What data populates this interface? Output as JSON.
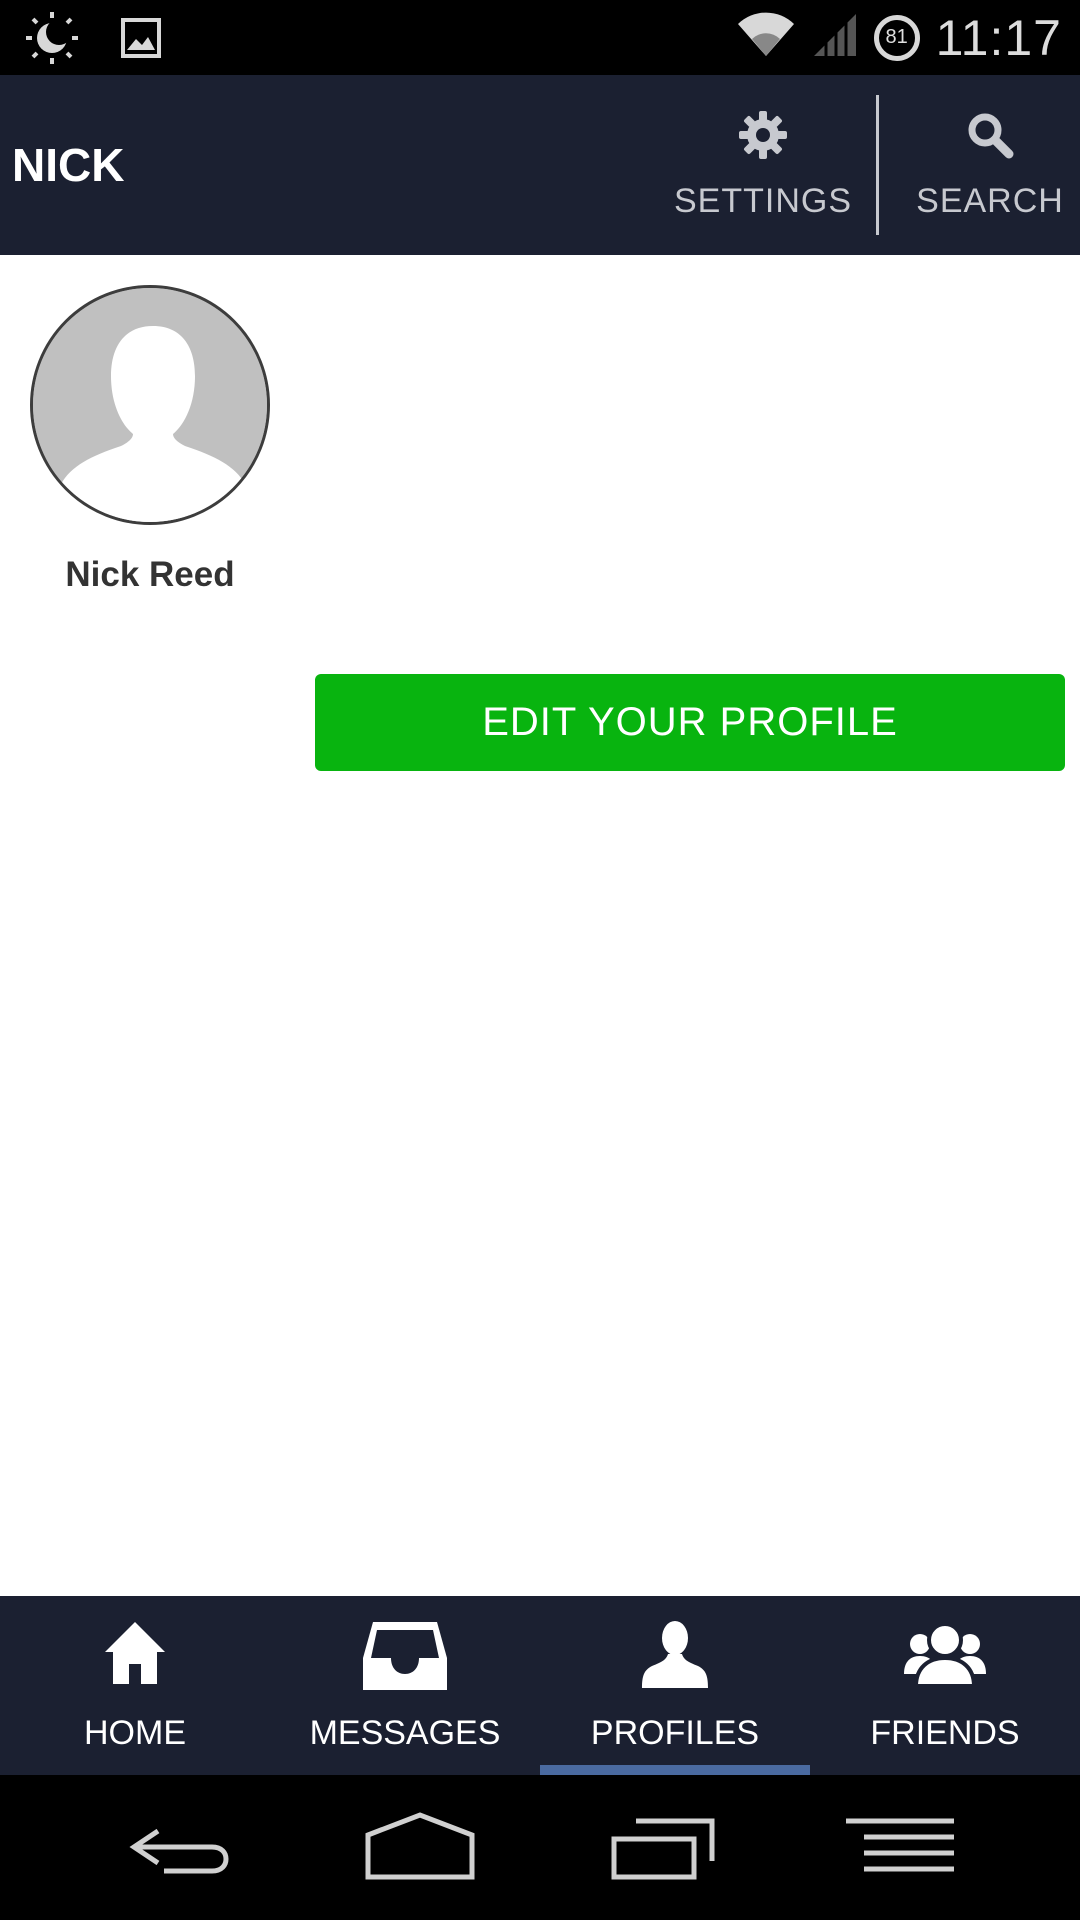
{
  "status_bar": {
    "time": "11:17",
    "battery_level": "81",
    "icons": [
      "brightness-icon",
      "image-icon",
      "wifi-icon",
      "signal-icon",
      "battery-icon"
    ]
  },
  "app_bar": {
    "title": "NICK",
    "settings_label": "SETTINGS",
    "search_label": "SEARCH",
    "background": "#1b2031"
  },
  "profile": {
    "name": "Nick Reed",
    "edit_button_label": "EDIT YOUR PROFILE",
    "accent": "#08b40f"
  },
  "bottom_nav": {
    "items": [
      {
        "label": "HOME",
        "icon": "home-icon"
      },
      {
        "label": "MESSAGES",
        "icon": "inbox-icon"
      },
      {
        "label": "PROFILES",
        "icon": "person-icon",
        "active": true
      },
      {
        "label": "FRIENDS",
        "icon": "group-icon"
      }
    ],
    "active_indicator_color": "#4a6aa0"
  },
  "system_nav": {
    "icons": [
      "back-icon",
      "home-outline-icon",
      "recents-icon",
      "menu-icon"
    ]
  }
}
